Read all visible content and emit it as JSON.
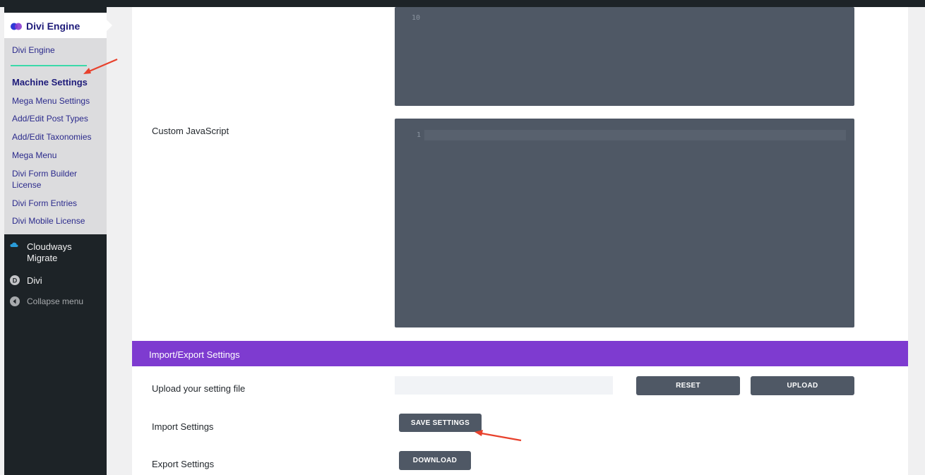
{
  "sidebar": {
    "brand": "Divi Engine",
    "submenu": [
      "Divi Engine",
      "Machine Settings",
      "Mega Menu Settings",
      "Add/Edit Post Types",
      "Add/Edit Taxonomies",
      "Mega Menu",
      "Divi Form Builder License",
      "Divi Form Entries",
      "Divi Mobile License"
    ],
    "current_submenu": "Machine Settings",
    "menu": [
      {
        "label": "Cloudways Migrate",
        "icon": "cloud-icon"
      },
      {
        "label": "Divi",
        "icon": "divi-icon"
      },
      {
        "label": "Collapse menu",
        "icon": "collapse-icon"
      }
    ]
  },
  "content": {
    "top_editor": {
      "line_number": "10"
    },
    "custom_js": {
      "label": "Custom JavaScript",
      "line_number": "1"
    },
    "import_export": {
      "title": "Import/Export Settings",
      "upload_label": "Upload your setting file",
      "reset_label": "RESET",
      "upload_button_label": "UPLOAD",
      "import_label": "Import Settings",
      "save_label": "SAVE SETTINGS",
      "export_label": "Export Settings",
      "download_label": "DOWNLOAD"
    }
  },
  "colors": {
    "accent_purple": "#7e3bd0",
    "button_gray": "#4f5865",
    "annotation_red": "#e8412c"
  }
}
